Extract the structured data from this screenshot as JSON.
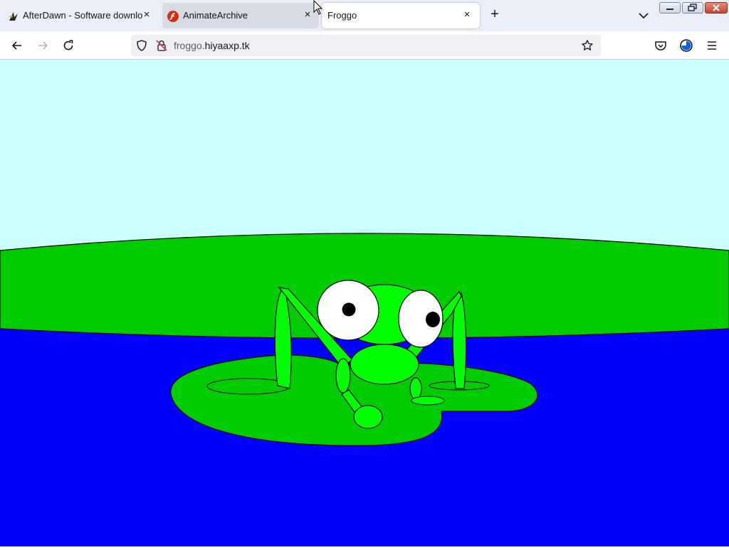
{
  "browser": {
    "tabs": [
      {
        "title": "AfterDawn - Software download",
        "active": false
      },
      {
        "title": "AnimateArchive",
        "active": false
      },
      {
        "title": "Froggo",
        "active": true
      }
    ],
    "close_glyph": "×",
    "new_tab_glyph": "+",
    "url": {
      "host_prefix": "froggo.",
      "host_domain": "hiyaaxp.tk"
    }
  },
  "icons": {
    "tab1_favicon": "afterdawn-favicon-icon",
    "tab2_favicon": "flash-favicon-icon",
    "back": "arrow-left-icon",
    "forward": "arrow-right-icon",
    "reload": "reload-icon",
    "tracking": "shield-icon",
    "insecure": "insecure-lock-icon",
    "bookmark": "star-icon",
    "pocket": "pocket-icon",
    "account": "account-icon",
    "menu": "hamburger-menu-icon"
  },
  "colors": {
    "sky": "#ccffff",
    "water": "#0000ff",
    "shore": "#00cc00",
    "lily_pad": "#00cc00",
    "frog_body": "#00ff00",
    "outline": "#000000"
  }
}
